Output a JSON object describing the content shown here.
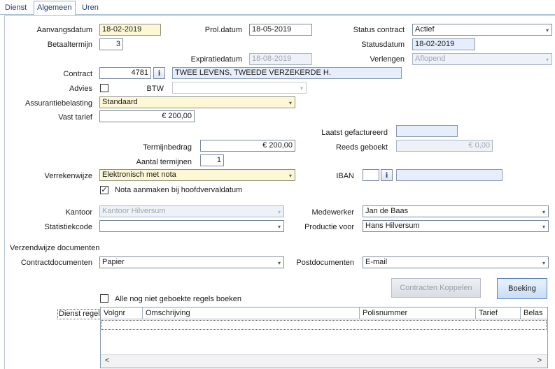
{
  "tabs": [
    {
      "label": "Dienst"
    },
    {
      "label": "Algemeen"
    },
    {
      "label": "Uren"
    }
  ],
  "aanvangsdatum": {
    "label": "Aanvangsdatum",
    "value": "18-02-2019"
  },
  "prol_datum": {
    "label": "Prol.datum",
    "value": "18-05-2019"
  },
  "status_contract": {
    "label": "Status contract",
    "value": "Actief"
  },
  "betaaltermijn": {
    "label": "Betaaltermijn",
    "value": "3"
  },
  "statusdatum": {
    "label": "Statusdatum",
    "value": "18-02-2019"
  },
  "expiratiedatum": {
    "label": "Expiratiedatum",
    "value": "18-08-2019"
  },
  "verlengen": {
    "label": "Verlengen",
    "value": "Aflopend"
  },
  "contract": {
    "label": "Contract",
    "number": "4781",
    "description": "TWEE LEVENS, TWEEDE VERZEKERDE H."
  },
  "advies": {
    "label": "Advies"
  },
  "btw": {
    "label": "BTW",
    "value": ""
  },
  "assurantiebelasting": {
    "label": "Assurantiebelasting",
    "value": "Standaard"
  },
  "vast_tarief": {
    "label": "Vast tarief",
    "value": "€ 200,00"
  },
  "laatst_gefactureerd": {
    "label": "Laatst gefactureerd",
    "value": ""
  },
  "termijnbedrag": {
    "label": "Termijnbedrag",
    "value": "€ 200,00"
  },
  "reeds_geboekt": {
    "label": "Reeds geboekt",
    "value": "€ 0,00"
  },
  "aantal_termijnen": {
    "label": "Aantal termijnen",
    "value": "1"
  },
  "verrekenwijze": {
    "label": "Verrekenwijze",
    "value": "Elektronisch met nota"
  },
  "iban": {
    "label": "IBAN",
    "value": ""
  },
  "nota_check": {
    "label": "Nota aanmaken bij hoofdvervaldatum",
    "checked": true
  },
  "kantoor": {
    "label": "Kantoor",
    "value": "Kantoor Hilversum"
  },
  "medewerker": {
    "label": "Medewerker",
    "value": "Jan de Baas"
  },
  "statistiekcode": {
    "label": "Statistiekcode",
    "value": ""
  },
  "productie_voor": {
    "label": "Productie voor",
    "value": "Hans Hilversum"
  },
  "verzendwijze": {
    "heading": "Verzendwijze documenten"
  },
  "contractdocumenten": {
    "label": "Contractdocumenten",
    "value": "Papier"
  },
  "postdocumenten": {
    "label": "Postdocumenten",
    "value": "E-mail"
  },
  "buttons": {
    "koppelen": "Contracten Koppelen",
    "boeking": "Boeking"
  },
  "alle_regels": {
    "label": "Alle nog niet geboekte regels boeken",
    "checked": false
  },
  "dienstregel": {
    "label": "Dienst regel"
  },
  "grid": {
    "columns": [
      "Volgnr",
      "Omschrijving",
      "Polisnummer",
      "Tarief",
      "Belas"
    ],
    "scroll_left": "<",
    "scroll_right": ">"
  },
  "check_glyph": "✓",
  "dropdown_glyph": "▾",
  "info_glyph": "i",
  "colors": {
    "yellow_field": "#fcf8d6",
    "blue_field": "#e7eefb",
    "disabled_field": "#eef1f7",
    "accent": "#1f3a66"
  }
}
